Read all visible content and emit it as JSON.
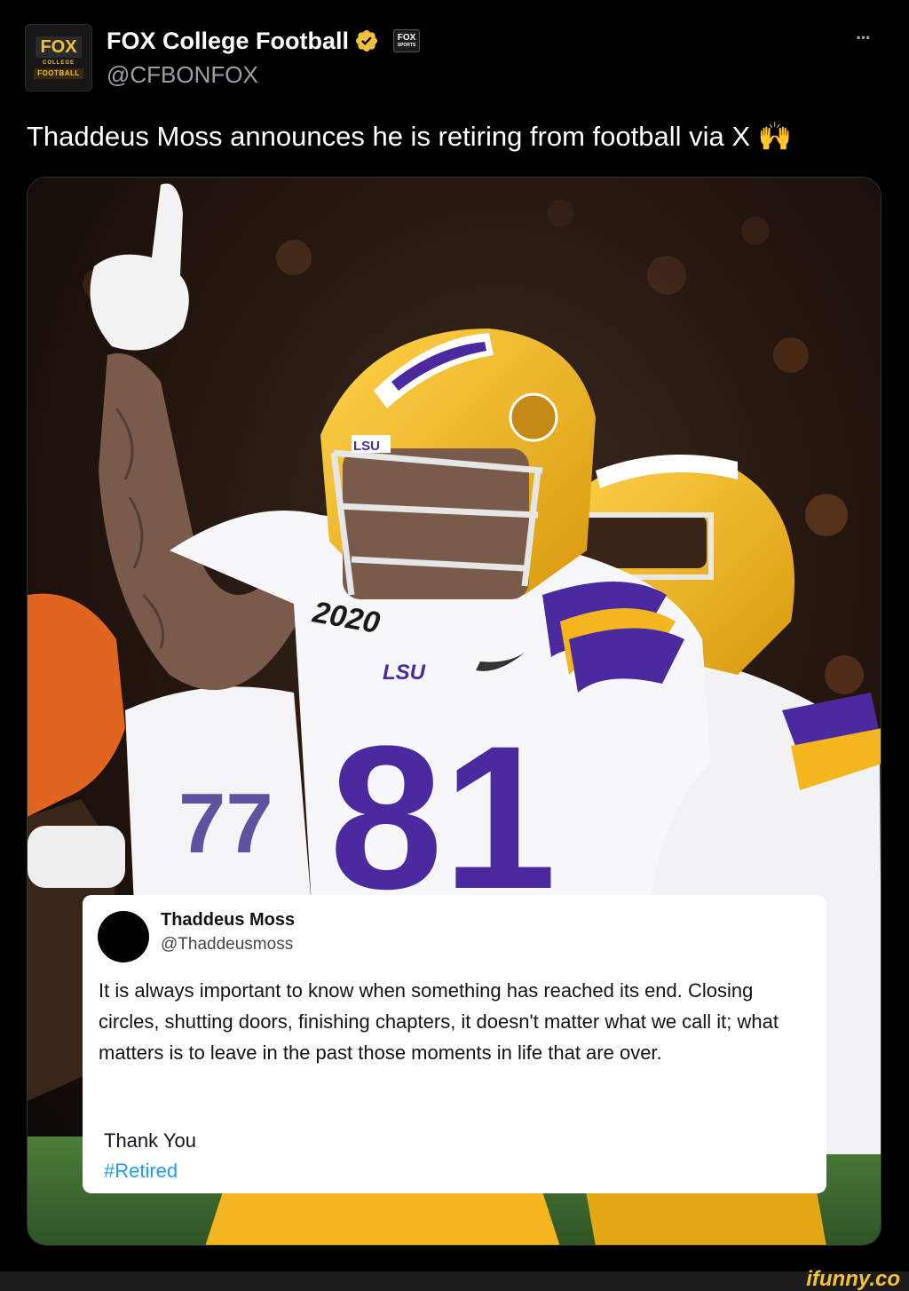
{
  "tweet": {
    "author": {
      "display_name": "FOX College Football",
      "handle": "@CFBONFOX",
      "avatar_text": {
        "line1": "FOX",
        "line2": "COLLEGE",
        "line3": "FOOTBALL"
      },
      "affiliate_badge": {
        "line1": "FOX",
        "line2": "SPORTS"
      },
      "verified_icon": "verified-badge-icon",
      "verified_color": "#f0c23b"
    },
    "more_label": "···",
    "text": "Thaddeus Moss announces he is retiring from football via X 🙌"
  },
  "media": {
    "jersey_number": "81",
    "helmet_text": "LSU",
    "chest_text": "LSU",
    "patch_text": "2020",
    "background_number": "77",
    "colors": {
      "purple": "#4b2aa0",
      "gold": "#f3b61f",
      "crowd": "#2a1d1a"
    }
  },
  "quoted_post": {
    "name": "Thaddeus Moss",
    "handle": "@Thaddeusmoss",
    "body": "It is always important to know when something has reached its end. Closing circles, shutting doors, finishing chapters, it doesn't matter what we call it; what matters is to leave in the past those moments in life that are over.",
    "closing": "Thank You",
    "hashtag": "#Retired",
    "hashtag_color": "#1d9bf0"
  },
  "watermark": "ifunny.co"
}
